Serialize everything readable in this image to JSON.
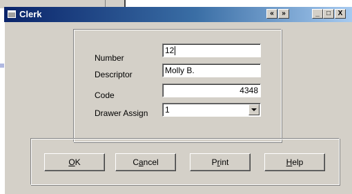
{
  "window": {
    "title": "Clerk",
    "controls": {
      "prev": "«",
      "next": "»",
      "minimize": "_",
      "maximize": "□",
      "close": "X"
    }
  },
  "form": {
    "number": {
      "label": "Number",
      "value": "12"
    },
    "descriptor": {
      "label": "Descriptor",
      "value": "Molly B."
    },
    "code": {
      "label": "Code",
      "value": "4348"
    },
    "drawer_assign": {
      "label": "Drawer Assign",
      "value": "1"
    }
  },
  "buttons": {
    "ok": {
      "accel": "O",
      "rest": "K"
    },
    "cancel": {
      "pre": "C",
      "accel": "a",
      "rest": "ncel"
    },
    "print": {
      "pre": "P",
      "accel": "r",
      "rest": "int"
    },
    "help": {
      "accel": "H",
      "rest": "elp"
    }
  }
}
